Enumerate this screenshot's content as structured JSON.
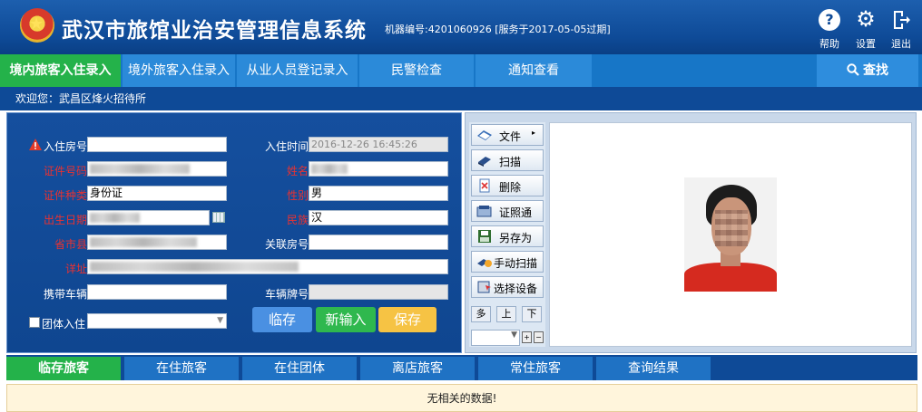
{
  "header": {
    "title": "武汉市旅馆业治安管理信息系统",
    "machine_info": "机器编号:4201060926 [服务于2017-05-05过期]",
    "buttons": {
      "help": "帮助",
      "settings": "设置",
      "logout": "退出"
    }
  },
  "nav": {
    "tabs": [
      {
        "label": "境内旅客入住录入",
        "active": true
      },
      {
        "label": "境外旅客入住录入"
      },
      {
        "label": "从业人员登记录入"
      },
      {
        "label": "民警检查"
      },
      {
        "label": "通知查看"
      }
    ],
    "search": "查找"
  },
  "welcome": "欢迎您：武昌区烽火招待所",
  "form": {
    "room_label": "入住房号",
    "room_value": "",
    "checkin_time_label": "入住时间",
    "checkin_time_value": "2016-12-26 16:45:26",
    "id_number_label": "证件号码",
    "name_label": "姓名",
    "id_type_label": "证件种类",
    "id_type_value": "身份证",
    "gender_label": "性别",
    "gender_value": "男",
    "birth_label": "出生日期",
    "ethnicity_label": "民族",
    "ethnicity_value": "汉",
    "region_label": "省市县",
    "linked_room_label": "关联房号",
    "linked_room_value": "",
    "address_label": "详址",
    "vehicle_label": "携带车辆",
    "vehicle_value": "",
    "plate_label": "车辆牌号",
    "plate_value": "",
    "group_label": "团体入住",
    "buttons": {
      "temp": "临存",
      "new": "新输入",
      "save": "保存"
    }
  },
  "scanner": {
    "buttons": [
      "文件",
      "扫描",
      "删除",
      "证照通",
      "另存为",
      "手动扫描",
      "选择设备"
    ],
    "mini": [
      "多",
      "上",
      "下"
    ]
  },
  "bottom_tabs": [
    {
      "label": "临存旅客",
      "active": true
    },
    {
      "label": "在住旅客"
    },
    {
      "label": "在住团体"
    },
    {
      "label": "离店旅客"
    },
    {
      "label": "常住旅客"
    },
    {
      "label": "查询结果"
    }
  ],
  "result_message": "无相关的数据!"
}
